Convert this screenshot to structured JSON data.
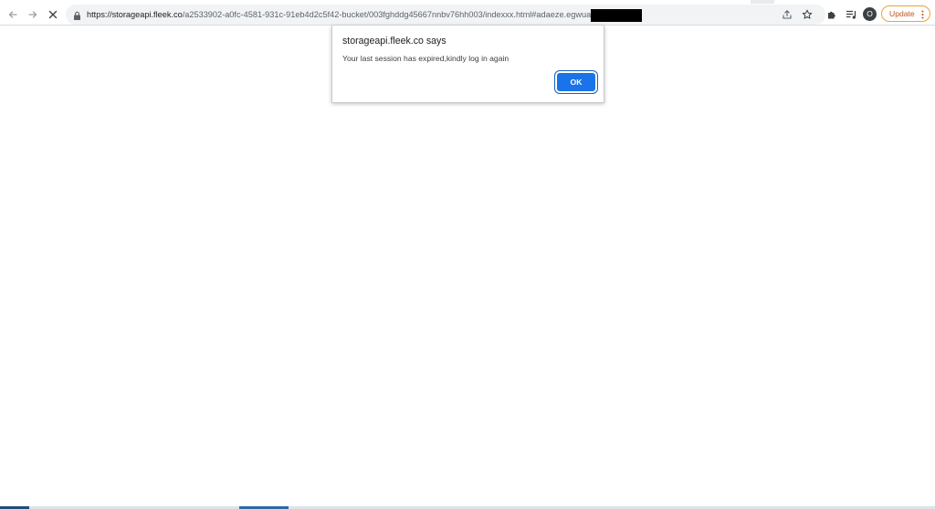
{
  "browser": {
    "url_host": "https://storageapi.fleek.co",
    "url_path": "/a2533902-a0fc-4581-931c-91eb4d2c5f42-bucket/003fghddg45667nnbv76hh003/indexxx.html#adaeze.egwuatu",
    "profile_initial": "O",
    "update_label": "Update"
  },
  "dialog": {
    "title": "storageapi.fleek.co says",
    "message": "Your last session has expired,kindly log in again",
    "ok_label": "OK"
  },
  "colors": {
    "accent": "#1a73e8",
    "update_border": "#e8a33a",
    "update_text": "#c5531c"
  },
  "icons": [
    "back-arrow-icon",
    "forward-arrow-icon",
    "stop-icon",
    "lock-icon",
    "share-icon",
    "star-icon",
    "puzzle-icon",
    "media-icon",
    "more-vert-icon"
  ]
}
